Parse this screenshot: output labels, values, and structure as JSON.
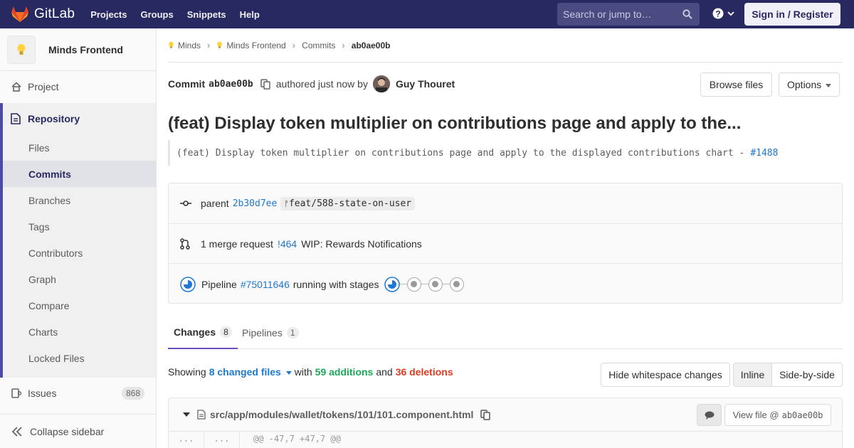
{
  "navbar": {
    "brand": "GitLab",
    "links": [
      "Projects",
      "Groups",
      "Snippets",
      "Help"
    ],
    "search_placeholder": "Search or jump to…",
    "signin_label": "Sign in / Register",
    "bg_color": "#292961"
  },
  "sidebar": {
    "project_name": "Minds Frontend",
    "project_label": "Project",
    "repository_label": "Repository",
    "repository_items": [
      "Files",
      "Commits",
      "Branches",
      "Tags",
      "Contributors",
      "Graph",
      "Compare",
      "Charts",
      "Locked Files"
    ],
    "active_item": "Commits",
    "issues_label": "Issues",
    "issues_count": "868",
    "collapse_label": "Collapse sidebar"
  },
  "breadcrumbs": [
    "Minds",
    "Minds Frontend",
    "Commits",
    "ab0ae00b"
  ],
  "commit": {
    "label": "Commit",
    "sha": "ab0ae00b",
    "authored_text": "authored just now by",
    "author": "Guy Thouret",
    "browse_label": "Browse files",
    "options_label": "Options",
    "title": "(feat) Display token multiplier on contributions page and apply to the...",
    "description": "(feat) Display token multiplier on contributions page and apply to the displayed contributions chart -",
    "description_ref": "#1488"
  },
  "info": {
    "parent_label": "parent",
    "parent_sha": "2b30d7ee",
    "branch": "feat/588-state-on-user",
    "mr_text": "1 merge request",
    "mr_ref": "!464",
    "mr_title": "WIP: Rewards Notifications",
    "pipeline_label": "Pipeline",
    "pipeline_ref": "#75011646",
    "pipeline_status": "running with stages"
  },
  "tabs": [
    {
      "label": "Changes",
      "count": "8"
    },
    {
      "label": "Pipelines",
      "count": "1"
    }
  ],
  "diff_summary": {
    "showing": "Showing",
    "files": "8 changed files",
    "with": "with",
    "additions": "59 additions",
    "and": "and",
    "deletions": "36 deletions",
    "hide_whitespace": "Hide whitespace changes",
    "inline": "Inline",
    "side_by_side": "Side-by-side"
  },
  "file": {
    "path": "src/app/modules/wallet/tokens/101/101.component.html",
    "view_file_label": "View file @",
    "view_file_sha": "ab0ae00b",
    "line_old": "...",
    "line_new": "...",
    "hunk": "@@ -47,7 +47,7 @@"
  },
  "colors": {
    "link": "#1f78d1",
    "additions": "#1aaa55",
    "deletions": "#db3b21",
    "accent": "#6b4fbb"
  }
}
